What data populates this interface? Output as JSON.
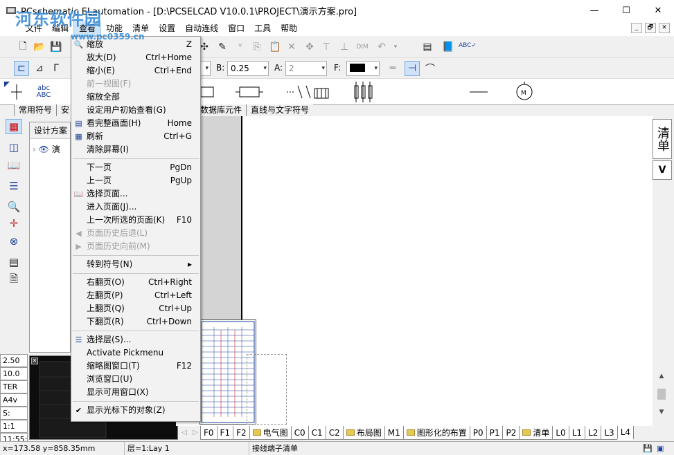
{
  "titlebar": {
    "title": "PCschematic ELautomation - [D:\\PCSELCAD V10.0.1\\PROJECT\\演示方案.pro]",
    "minimize": "—",
    "maximize": "☐",
    "close": "✕"
  },
  "watermark": {
    "text": "河东软件园",
    "url": "www.pc0359.cn"
  },
  "menubar": {
    "items": [
      "文件",
      "编辑",
      "查看",
      "功能",
      "清单",
      "设置",
      "自动连线",
      "窗口",
      "工具",
      "帮助"
    ],
    "mdi": [
      "_",
      "🗗",
      "✕"
    ]
  },
  "toolbar2": {
    "b_label": "B:",
    "b_value": "0.25",
    "a_label": "A:",
    "a_value": "2",
    "f_label": "F:"
  },
  "symbolbar": {
    "abc_label": "abc\nABC"
  },
  "tabstrip": {
    "tabs": [
      "常用符号",
      "安",
      "数据库元件",
      "直线与文字符号"
    ]
  },
  "project_panel": {
    "header": "设计方案",
    "tree_item": "演"
  },
  "sidecells": [
    "2.50",
    "10.0",
    "TER",
    "A4v",
    "S:",
    "1:1",
    "11:55:"
  ],
  "right_tabs": {
    "tab1": "清单",
    "tab2": "V"
  },
  "page_tabs": [
    {
      "label": "F0"
    },
    {
      "label": "F1"
    },
    {
      "label": "F2"
    },
    {
      "label": "电气图",
      "folder": true
    },
    {
      "label": "C0"
    },
    {
      "label": "C1"
    },
    {
      "label": "C2"
    },
    {
      "label": "布局图",
      "folder": true
    },
    {
      "label": "M1"
    },
    {
      "label": "图形化的布置",
      "folder": true
    },
    {
      "label": "P0"
    },
    {
      "label": "P1"
    },
    {
      "label": "P2"
    },
    {
      "label": "清单",
      "folder": true
    },
    {
      "label": "L0"
    },
    {
      "label": "L1"
    },
    {
      "label": "L2"
    },
    {
      "label": "L3"
    },
    {
      "label": "L4"
    }
  ],
  "statusbar": {
    "coords": "x=173.58 y=858.35mm",
    "layer": "层=1:Lay 1",
    "message": "接线端子清单"
  },
  "dropdown": {
    "items": [
      {
        "label": "缩放",
        "shortcut": "Z",
        "icon": "zoom-icon"
      },
      {
        "label": "放大(D)",
        "shortcut": "Ctrl+Home"
      },
      {
        "label": "缩小(E)",
        "shortcut": "Ctrl+End"
      },
      {
        "label": "前一视图(F)",
        "shortcut": "",
        "disabled": true
      },
      {
        "label": "缩放全部",
        "shortcut": ""
      },
      {
        "label": "设定用户初始查看(G)",
        "shortcut": ""
      },
      {
        "label": "看完整画面(H)",
        "shortcut": "Home",
        "icon": "page-icon"
      },
      {
        "label": "刷新",
        "shortcut": "Ctrl+G",
        "icon": "refresh-icon"
      },
      {
        "label": "清除屏幕(I)",
        "shortcut": ""
      },
      {
        "label": "下一页",
        "shortcut": "PgDn"
      },
      {
        "label": "上一页",
        "shortcut": "PgUp"
      },
      {
        "label": "选择页面...",
        "shortcut": "",
        "icon": "book-icon"
      },
      {
        "label": "进入页面(J)...",
        "shortcut": ""
      },
      {
        "label": "上一次所选的页面(K)",
        "shortcut": "F10"
      },
      {
        "label": "页面历史后退(L)",
        "shortcut": "",
        "disabled": true,
        "icon": "back-arrow-icon"
      },
      {
        "label": "页面历史向前(M)",
        "shortcut": "",
        "disabled": true,
        "icon": "forward-arrow-icon"
      },
      {
        "label": "转到符号(N)",
        "shortcut": "",
        "submenu": true
      },
      {
        "label": "右翻页(O)",
        "shortcut": "Ctrl+Right"
      },
      {
        "label": "左翻页(P)",
        "shortcut": "Ctrl+Left"
      },
      {
        "label": "上翻页(Q)",
        "shortcut": "Ctrl+Up"
      },
      {
        "label": "下翻页(R)",
        "shortcut": "Ctrl+Down"
      },
      {
        "label": "选择层(S)...",
        "shortcut": "",
        "icon": "layer-icon"
      },
      {
        "label": "Activate Pickmenu",
        "shortcut": ""
      },
      {
        "label": "缩略图窗口(T)",
        "shortcut": "F12"
      },
      {
        "label": "浏览窗口(U)",
        "shortcut": ""
      },
      {
        "label": "显示可用窗口(X)",
        "shortcut": ""
      },
      {
        "label": "显示光标下的对象(Z)",
        "shortcut": "",
        "checked": true
      }
    ]
  },
  "colors": {
    "accent": "#2f86d4",
    "menu_active": "#cce4f7",
    "canvas": "#ffffff"
  }
}
